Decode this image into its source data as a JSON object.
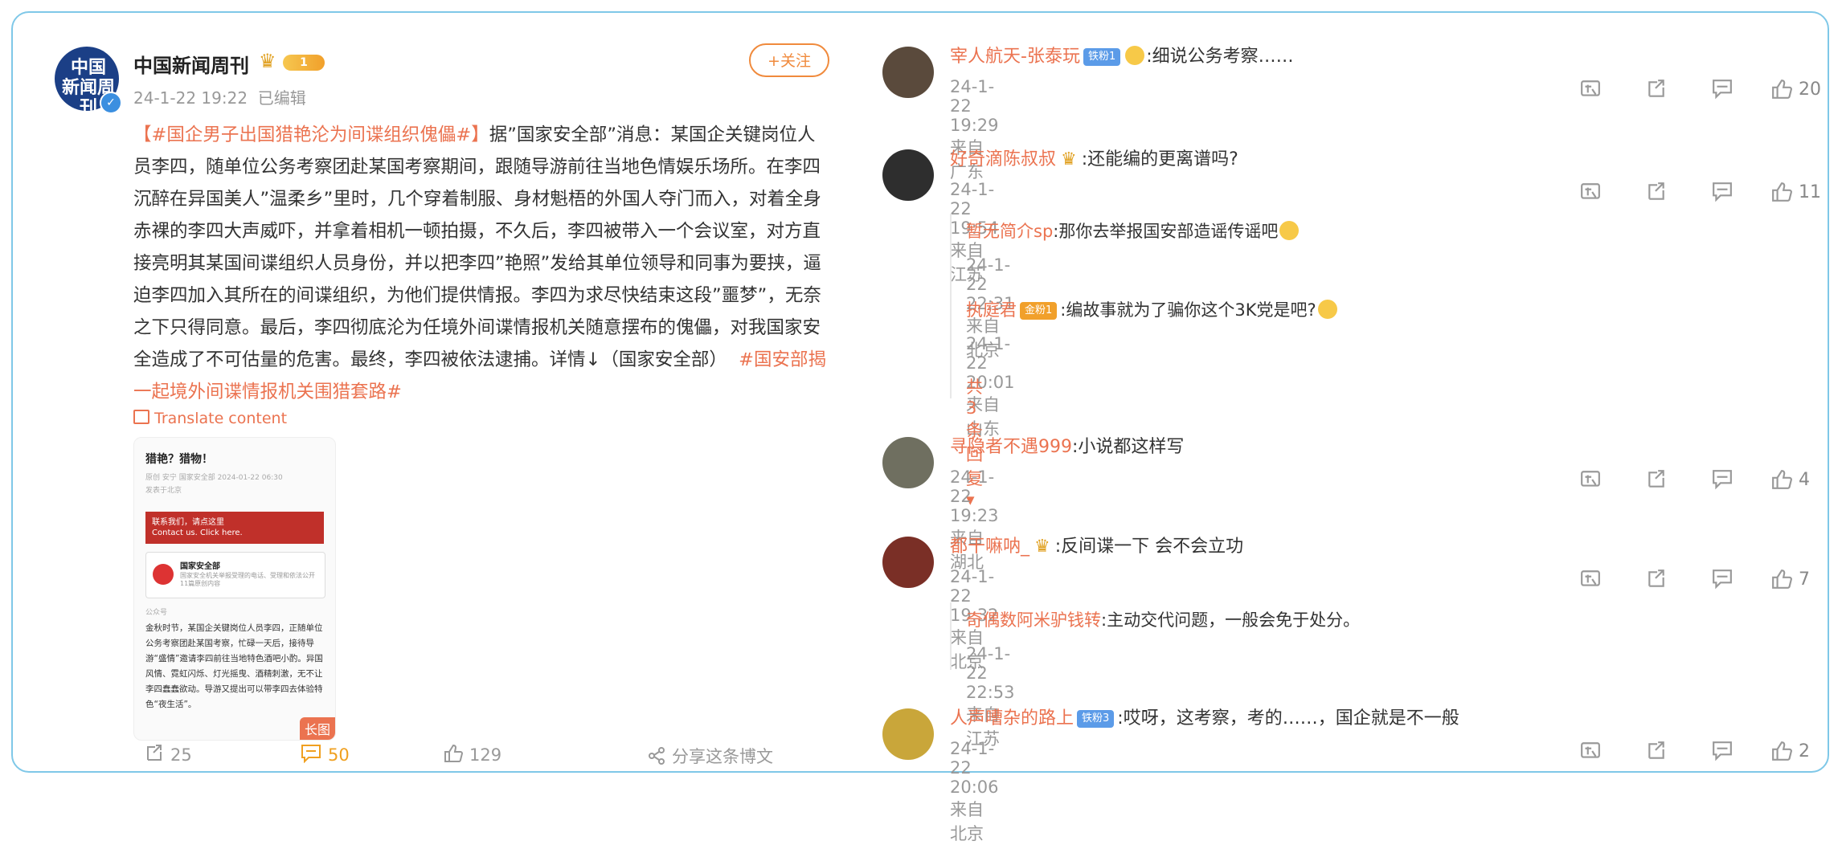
{
  "post": {
    "author": "中国新闻周刊",
    "avatar_text": "中国\n新闻周刊",
    "vip_level": "1",
    "time": "24-1-22 19:22",
    "edited": "已编辑",
    "follow_label": "+关注",
    "tag_start": "【#国企男子出国猎艳沦为间谍组织傀儡#】",
    "body": "据”国家安全部”消息：某国企关键岗位人员李四，随单位公务考察团赴某国考察期间，跟随导游前往当地色情娱乐场所。在李四沉醉在异国美人”温柔乡”里时，几个穿着制服、身材魁梧的外国人夺门而入，对着全身赤裸的李四大声威吓，并拿着相机一顿拍摄，不久后，李四被带入一个会议室，对方直接亮明其某国间谍组织人员身份，并以把李四”艳照”发给其单位领导和同事为要挟，逼迫李四加入其所在的间谍组织，为他们提供情报。李四为求尽快结束这段”噩梦”，无奈之下只得同意。最后，李四彻底沦为任境外间谍情报机关随意摆布的傀儡，对我国家安全造成了不可估量的危害。最终，李四被依法逮捕。详情↓（国家安全部）",
    "tag_end": "#国安部揭一起境外间谍情报机关围猎套路#",
    "translate": "Translate content",
    "image": {
      "title": "猎艳？猎物！",
      "meta": "原创 安宁 国家安全部 2024-01-22 06:30",
      "src": "发表于北京",
      "banner": "联系我们，请点这里\nContact us. Click here.",
      "org": "国家安全部",
      "org_desc": "国家安全机关举报受理的电话、受理和依法公开 11篇原创内容",
      "date": "公众号",
      "text": "金秋时节，某国企关键岗位人员李四，正随单位公务考察团赴某国考察，忙碌一天后，接待导游“盛情”邀请李四前往当地特色酒吧小酌。异国风情、霓虹闪烁、灯光摇曳、酒精刺激，无不让李四蠢蠢欲动。导游又提出可以带李四去体验特色“夜生活”。",
      "badge": "长图"
    },
    "actions": {
      "repost": "25",
      "comment": "50",
      "like": "129",
      "share": "分享这条博文"
    }
  },
  "comments": [
    {
      "name": "宰人航天-张泰玩",
      "badge": "铁粉1",
      "badge_type": "blue",
      "text": ":细说公务考察……",
      "emoji": true,
      "time": "24-1-22 19:29 来自广东",
      "likes": "20",
      "avatar_color": "#5a4a3c"
    },
    {
      "name": "好奇滴陈叔叔",
      "badge": "",
      "crown": true,
      "text": ":还能编的更离谱吗?",
      "time": "24-1-22 19:54 来自江苏",
      "likes": "11",
      "avatar_color": "#2e2e2e",
      "replies": [
        {
          "name": "暂无简介sp",
          "text": ":那你去举报国安部造谣传谣吧",
          "emoji": true,
          "time": "24-1-22 22:31 来自北京"
        },
        {
          "name": "执庭君",
          "badge": "金粉1",
          "text": ":编故事就为了骗你这个3K党是吧?",
          "emoji": true,
          "time": "24-1-22 20:01 来自山东"
        }
      ],
      "more": "共3条回复"
    },
    {
      "name": "寻隐者不遇999",
      "badge": "",
      "text": ":小说都这样写",
      "time": "24-1-22 19:23 来自湖北",
      "likes": "4",
      "avatar_color": "#6f6f60"
    },
    {
      "name": "都干嘛呐_",
      "badge": "",
      "crown": true,
      "text": ":反间谍一下 会不会立功",
      "time": "24-1-22 19:32 来自北京",
      "likes": "7",
      "avatar_color": "#7a2f26",
      "replies": [
        {
          "name": "奇偶数阿米驴钱转",
          "text": ":主动交代问题，一般会免于处分。",
          "time": "24-1-22 22:53 来自江苏"
        }
      ]
    },
    {
      "name": "人声嘈杂的路上",
      "badge": "铁粉3",
      "badge_type": "blue",
      "text": ":哎呀，这考察，考的……，国企就是不一般",
      "time": "24-1-22 20:06 来自北京",
      "likes": "2",
      "avatar_color": "#c9a63a"
    }
  ]
}
